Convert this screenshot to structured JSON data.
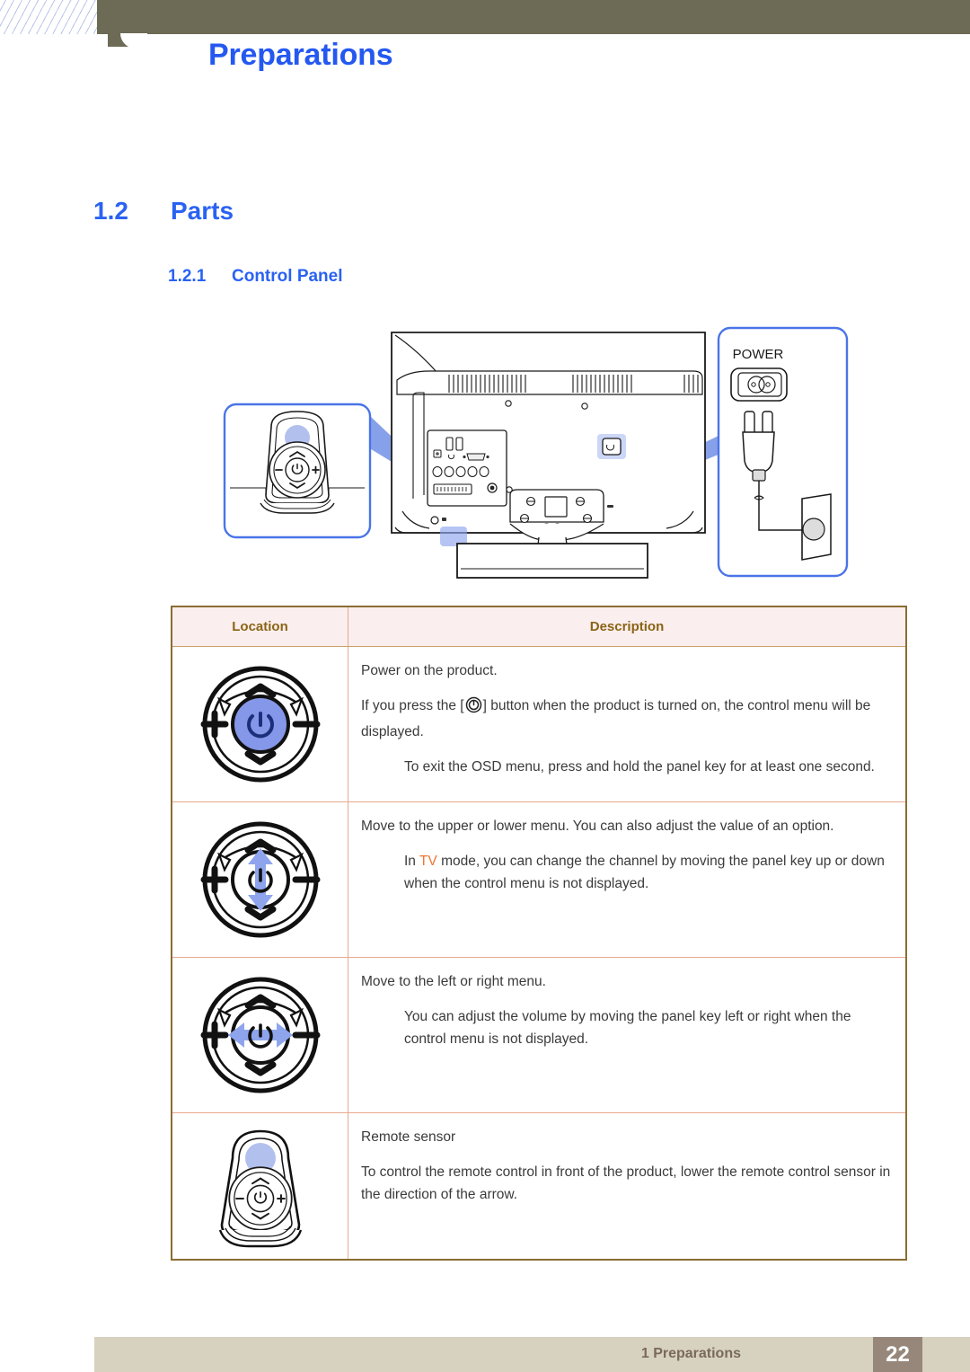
{
  "header": {
    "title": "Preparations"
  },
  "section": {
    "number": "1.2",
    "title": "Parts",
    "sub_number": "1.2.1",
    "sub_title": "Control Panel"
  },
  "figure": {
    "power_label": "POWER",
    "callout_left_name": "control-panel-closeup",
    "callout_right_name": "power-connection-closeup"
  },
  "table": {
    "headers": [
      "Location",
      "Description"
    ],
    "rows": [
      {
        "icon": "joystick-power-highlight-icon",
        "lines": [
          {
            "text": "Power on the product.",
            "indent": false
          },
          {
            "pre": "If you press the [",
            "icon": "power-symbol-icon",
            "post": "] button when the product is turned on, the control menu will be displayed.",
            "indent": false
          },
          {
            "text": "To exit the OSD menu, press and hold the panel key for at least one second.",
            "indent": true
          }
        ]
      },
      {
        "icon": "joystick-vertical-arrow-icon",
        "lines": [
          {
            "text": "Move to the upper or lower menu. You can also adjust the value of an option.",
            "indent": false
          },
          {
            "pre": "In ",
            "accent": "TV",
            "post": " mode, you can change the channel by moving the panel key up or down when the control menu is not displayed.",
            "indent": true
          }
        ]
      },
      {
        "icon": "joystick-horizontal-arrow-icon",
        "lines": [
          {
            "text": "Move to the left or right menu.",
            "indent": false
          },
          {
            "text": "You can adjust the volume by moving the panel key left or right when the control menu is not displayed.",
            "indent": true
          }
        ]
      },
      {
        "icon": "remote-sensor-stand-icon",
        "lines": [
          {
            "text": "Remote sensor",
            "indent": false
          },
          {
            "text": "To control the remote control in front of the product, lower the remote control sensor in the direction of the arrow.",
            "indent": false
          }
        ]
      }
    ]
  },
  "footer": {
    "chapter": "1 Preparations",
    "page": "22"
  },
  "colors": {
    "heading_blue": "#2a62f2",
    "header_olive": "#6d6a55",
    "table_header_bg": "#fbeeee",
    "table_header_text": "#8a6415",
    "table_border": "#8a6d32",
    "accent_orange": "#ef7532",
    "callout_blue": "#4a74e8",
    "highlight_blue": "#8ea5ee",
    "footer_bg": "#d7d2bf",
    "page_badge_bg": "#96877a"
  }
}
